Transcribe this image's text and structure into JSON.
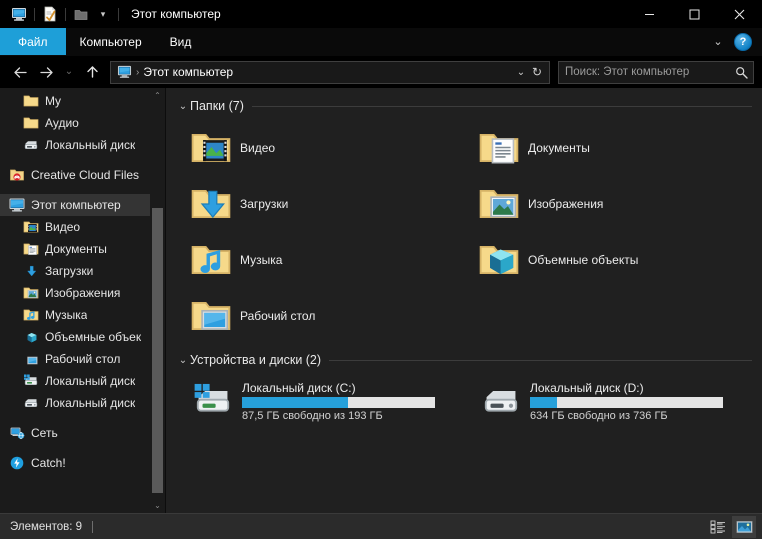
{
  "window": {
    "title": "Этот компьютер",
    "quick_access": [
      "computer-icon",
      "properties-icon",
      "new-folder-icon"
    ],
    "dropdown_glyph": "▾",
    "minimize_glyph": "—",
    "maximize_glyph": "▢",
    "close_glyph": "✕"
  },
  "ribbon": {
    "tabs": [
      {
        "label": "Файл",
        "active": true
      },
      {
        "label": "Компьютер",
        "active": false
      },
      {
        "label": "Вид",
        "active": false
      }
    ],
    "collapse_glyph": "⌄",
    "help_label": "?"
  },
  "address": {
    "back_glyph": "←",
    "forward_glyph": "→",
    "recent_glyph": "⌄",
    "up_glyph": "↑",
    "breadcrumb_icon": "computer-icon",
    "breadcrumb_sep": "›",
    "path": "Этот компьютер",
    "dropdown_glyph": "⌄",
    "refresh_glyph": "↻"
  },
  "search": {
    "placeholder": "Поиск: Этот компьютер",
    "value": "",
    "icon": "search-icon"
  },
  "sidebar": {
    "items": [
      {
        "label": "My",
        "icon": "folder-icon",
        "indent": 2,
        "selected": false
      },
      {
        "label": "Аудио",
        "icon": "folder-icon",
        "indent": 2,
        "selected": false
      },
      {
        "label": "Локальный диск",
        "icon": "drive-icon",
        "indent": 2,
        "selected": false
      },
      {
        "label": "Creative Cloud Files",
        "icon": "creative-cloud-icon",
        "indent": 1,
        "selected": false,
        "gap_before": true
      },
      {
        "label": "Этот компьютер",
        "icon": "computer-icon",
        "indent": 1,
        "selected": true,
        "gap_before": true
      },
      {
        "label": "Видео",
        "icon": "video-folder-icon",
        "indent": 2,
        "selected": false
      },
      {
        "label": "Документы",
        "icon": "documents-folder-icon",
        "indent": 2,
        "selected": false
      },
      {
        "label": "Загрузки",
        "icon": "downloads-icon",
        "indent": 2,
        "selected": false
      },
      {
        "label": "Изображения",
        "icon": "pictures-folder-icon",
        "indent": 2,
        "selected": false
      },
      {
        "label": "Музыка",
        "icon": "music-folder-icon",
        "indent": 2,
        "selected": false
      },
      {
        "label": "Объемные объек",
        "icon": "3d-objects-icon",
        "indent": 2,
        "selected": false
      },
      {
        "label": "Рабочий стол",
        "icon": "desktop-icon",
        "indent": 2,
        "selected": false
      },
      {
        "label": "Локальный диск",
        "icon": "system-drive-icon",
        "indent": 2,
        "selected": false
      },
      {
        "label": "Локальный диск",
        "icon": "drive-icon",
        "indent": 2,
        "selected": false
      },
      {
        "label": "Сеть",
        "icon": "network-icon",
        "indent": 1,
        "selected": false,
        "gap_before": true
      },
      {
        "label": "Catch!",
        "icon": "catch-icon",
        "indent": 1,
        "selected": false,
        "gap_before": true
      }
    ],
    "scroll_up_glyph": "⌃",
    "scroll_down_glyph": "⌄"
  },
  "main": {
    "folders_group": {
      "title": "Папки (7)",
      "chevron": "⌄",
      "items": [
        {
          "label": "Видео",
          "icon": "video-folder-icon"
        },
        {
          "label": "Документы",
          "icon": "documents-folder-icon"
        },
        {
          "label": "Загрузки",
          "icon": "downloads-folder-icon"
        },
        {
          "label": "Изображения",
          "icon": "pictures-folder-icon"
        },
        {
          "label": "Музыка",
          "icon": "music-folder-icon"
        },
        {
          "label": "Объемные объекты",
          "icon": "3d-objects-folder-icon"
        },
        {
          "label": "Рабочий стол",
          "icon": "desktop-folder-icon"
        }
      ]
    },
    "devices_group": {
      "title": "Устройства и диски (2)",
      "chevron": "⌄",
      "items": [
        {
          "name": "Локальный диск (C:)",
          "icon": "system-drive-icon",
          "free_text": "87,5 ГБ свободно из 193 ГБ",
          "used_percent": 55,
          "bar_fill_color": "#26a0da",
          "bar_track_color": "#e4e4e4"
        },
        {
          "name": "Локальный диск (D:)",
          "icon": "drive-icon",
          "free_text": "634 ГБ свободно из 736 ГБ",
          "used_percent": 14,
          "bar_fill_color": "#26a0da",
          "bar_track_color": "#e4e4e4"
        }
      ]
    }
  },
  "statusbar": {
    "count_text": "Элементов: 9",
    "details_view_icon": "details-view-icon",
    "large_icons_view_icon": "large-icons-view-icon",
    "active_view": "large-icons-view-icon"
  },
  "colors": {
    "accent": "#1e9fd8",
    "titlebar_bg": "#000000",
    "sidebar_bg": "#1b1b1b",
    "content_bg": "#202020",
    "statusbar_bg": "#2b2b2b",
    "selected_row": "#343434"
  }
}
